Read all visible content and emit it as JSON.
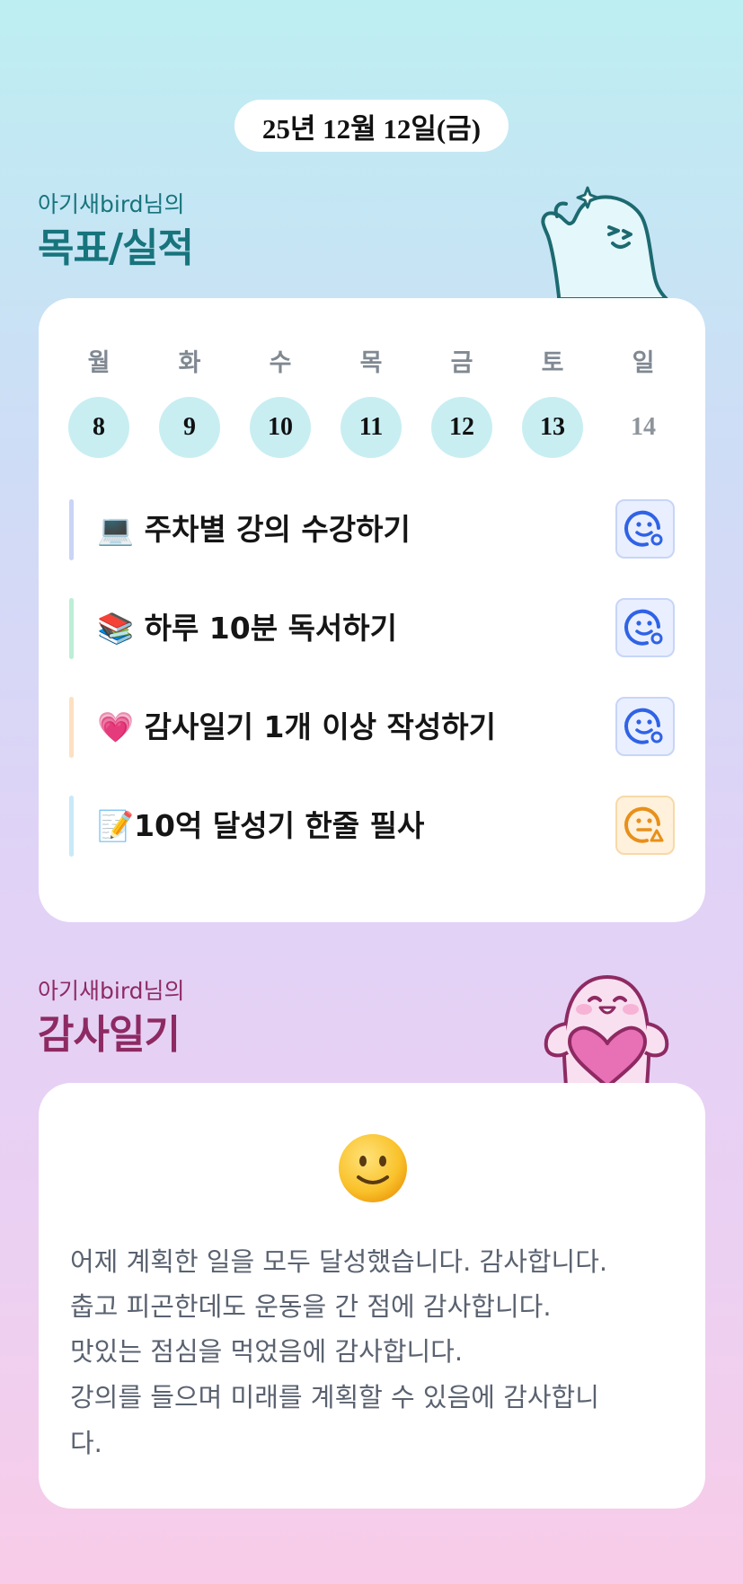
{
  "header": {
    "date": "25년 12월 12일(금)"
  },
  "goals_section": {
    "subtitle": "아기새bird님의",
    "title": "목표/실적"
  },
  "week": {
    "labels": [
      "월",
      "화",
      "수",
      "목",
      "금",
      "토",
      "일"
    ],
    "dates": [
      "8",
      "9",
      "10",
      "11",
      "12",
      "13",
      "14"
    ]
  },
  "goals": [
    {
      "emoji": "💻",
      "label": "주차별 강의 수강하기",
      "status": "achieved",
      "color": "#c9d4f6"
    },
    {
      "emoji": "📚",
      "label": "하루 10분 독서하기",
      "status": "achieved",
      "color": "#bdeed6"
    },
    {
      "emoji": "💗",
      "label": "감사일기 1개 이상 작성하기",
      "status": "achieved",
      "color": "#fde0c2"
    },
    {
      "emoji": "📝",
      "label": "10억 달성기 한줄 필사",
      "status": "partial",
      "color": "#c8e9f8"
    }
  ],
  "diary_section": {
    "subtitle": "아기새bird님의",
    "title": "감사일기"
  },
  "diary": {
    "mood_icon": "smiling-face-icon",
    "lines": [
      "어제 계획한 일을 모두 달성했습니다. 감사합니다.",
      "춥고 피곤한데도 운동을 간 점에 감사합니다.",
      "맛있는 점심을 먹었음에 감사합니다.",
      "강의를 들으며 미래를 계획할 수 있음에 감사합니",
      "다."
    ]
  },
  "colors": {
    "goals_title": "#17747c",
    "diary_title": "#8e2a63",
    "achieved_icon": "#2f62e6",
    "partial_icon": "#e8901a"
  }
}
